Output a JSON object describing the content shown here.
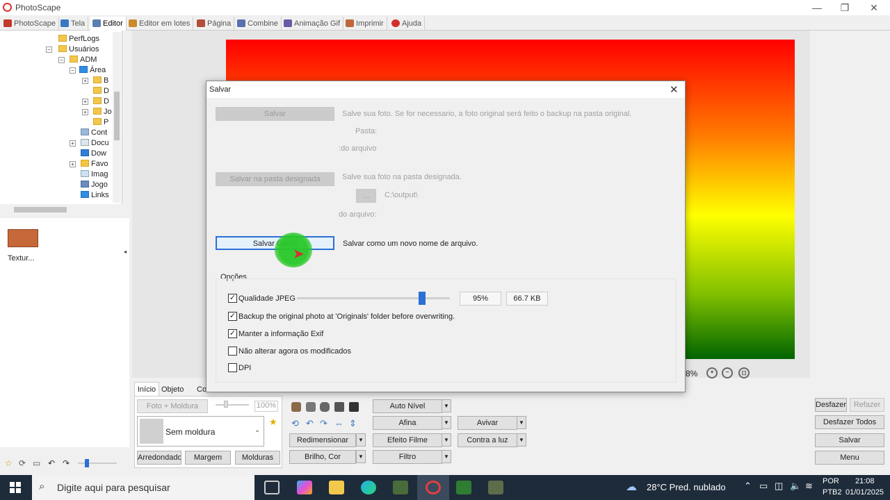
{
  "window": {
    "title": "PhotoScape",
    "min": "—",
    "max": "❐",
    "close": "✕"
  },
  "tabs": [
    {
      "label": "PhotoScape",
      "color": "#c0392b"
    },
    {
      "label": "Tela",
      "color": "#3a78c2"
    },
    {
      "label": "Editor",
      "color": "#5a7fb0"
    },
    {
      "label": "Editor em lotes",
      "color": "#c98a2a"
    },
    {
      "label": "Página",
      "color": "#b34d3b"
    },
    {
      "label": "Combine",
      "color": "#5a6fb0"
    },
    {
      "label": "Animação Gif",
      "color": "#6a5aa5"
    },
    {
      "label": "Imprimir",
      "color": "#c0673a"
    },
    {
      "label": "Ajuda",
      "color": "#d32f2f"
    }
  ],
  "tree": [
    "PerfLogs",
    "Usuários",
    "ADM",
    "Área",
    "B",
    "D",
    "D",
    "Jo",
    "P",
    "Cont",
    "Docu",
    "Dow",
    "Favo",
    "Imag",
    "Jogo",
    "Links"
  ],
  "thumbnail": {
    "label": "Textur..."
  },
  "status": {
    "zoom": "8%"
  },
  "right_buttons": {
    "undo": "Desfazer",
    "redo": "Refazer",
    "undo_all": "Desfazer Todos",
    "save": "Salvar",
    "menu": "Menu"
  },
  "panel": {
    "tabs": [
      "Início",
      "Objeto",
      "Co"
    ],
    "frame_btn": "Foto + Moldura",
    "percent": "100%",
    "frame_select": "Sem moldura",
    "round": "Arredondado",
    "margin": "Margem",
    "frames": "Molduras",
    "resize": "Redimensionar",
    "brightness": "Brilho, Cor",
    "auto_level": "Auto Nível",
    "sharpen": "Afina",
    "film": "Efeito Filme",
    "filter": "Filtro",
    "revive": "Avivar",
    "backlight": "Contra a luz"
  },
  "dialog": {
    "title": "Salvar",
    "save": "Salvar",
    "save_desc": "Salve sua foto. Se for necessario, a foto original será feito o backup na pasta original.",
    "folder_label": "Pasta:",
    "file_label1": "do arquivo:",
    "save_folder": "Salvar na pasta designada",
    "save_folder_desc": "Salve sua foto na pasta designada.",
    "browse": "...",
    "output_path": "C:\\output\\",
    "file_label2": "do arquivo:",
    "save_as": "Salvar Como",
    "save_as_desc": "Salvar como um novo nome de arquivo.",
    "options_title": "Opções",
    "jpeg_quality": "Qualidade JPEG",
    "quality_value": 95,
    "quality_text": "95%",
    "size_text": "66.7 KB",
    "opt_backup": "Backup the original photo at 'Originals' folder before overwriting.",
    "opt_exif": "Manter a informação Exif",
    "opt_nochange": "Não alterar agora os modificados",
    "opt_dpi": "DPI",
    "checks": {
      "jpeg": true,
      "backup": true,
      "exif": true,
      "nochange": false,
      "dpi": false
    }
  },
  "taskbar": {
    "search_placeholder": "Digite aqui para pesquisar",
    "weather": "28°C  Pred. nublado",
    "lang1": "POR",
    "lang2": "PTB2",
    "time": "21:08",
    "date": "01/01/2025"
  }
}
